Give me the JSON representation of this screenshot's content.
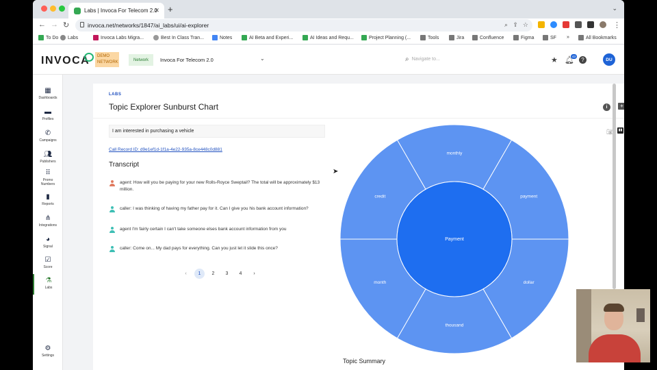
{
  "browser": {
    "tab_title": "Labs | Invoca For Telecom 2.0",
    "url": "invoca.net/networks/1847/ai_labs/ui/ai-explorer",
    "bookmarks": [
      "To Do",
      "Labs",
      "Invoca Labs Migra...",
      "Best In Class Tran...",
      "Notes",
      "AI Beta and Experi...",
      "AI Ideas and Requ...",
      "Project Planning (...",
      "Tools",
      "Jira",
      "Confluence",
      "Figma",
      "SF"
    ],
    "more_bookmarks": "»",
    "all_bookmarks": "All Bookmarks"
  },
  "header": {
    "logo": "INVOCA",
    "demo_badge": "DEMO NETWORK",
    "network_button": "Network",
    "network_name": "Invoca For Telecom 2.0",
    "search_placeholder": "Navigate to...",
    "notification_count": "43",
    "avatar_initials": "DU"
  },
  "sidebar": {
    "items": [
      "Dashboards",
      "Profiles",
      "Campaigns",
      "Publishers",
      "Promo Numbers",
      "Reports",
      "Integrations",
      "Signal",
      "Score",
      "Labs"
    ],
    "settings": "Settings"
  },
  "page": {
    "section_label": "LABS",
    "title": "Topic Explorer Sunburst Chart",
    "query": "I am interested in purchasing a vehicle",
    "call_record": "Call Record ID: d9e1ef1d-1f1a-4e22-935a-8ce448c0d881",
    "transcript_title": "Transcript",
    "transcript": [
      {
        "role": "agent",
        "text": "agent: How will you be paying for your new Rolls-Royce Sweptail? The total will be approximately $13 million."
      },
      {
        "role": "caller",
        "text": "caller: I was thinking of having my father pay for it. Can I give you his bank account information?"
      },
      {
        "role": "caller",
        "text": "agent I'm fairly certain I can't take someone elses bank account information from you"
      },
      {
        "role": "caller",
        "text": "caller: Come on... My dad pays for everything. Can you just let it slide this once?"
      }
    ],
    "pagination": {
      "prev": "‹",
      "pages": [
        "1",
        "2",
        "3",
        "4"
      ],
      "current": "1",
      "next": "›"
    },
    "topic_summary": "Topic Summary"
  },
  "colors": {
    "inner_ring": "#1e6ef0",
    "outer_ring": "#5d94f2",
    "agent_icon": "#e07a5f",
    "caller_icon": "#3fbfb5",
    "accent": "#1e63d6"
  },
  "chart_data": {
    "type": "sunburst",
    "center": {
      "label": "Payment",
      "value": 6
    },
    "segments": [
      {
        "label": "monthly",
        "value": 1
      },
      {
        "label": "payment",
        "value": 1
      },
      {
        "label": "dollar",
        "value": 1
      },
      {
        "label": "thousand",
        "value": 1
      },
      {
        "label": "month",
        "value": 1
      },
      {
        "label": "credit",
        "value": 1
      }
    ]
  }
}
